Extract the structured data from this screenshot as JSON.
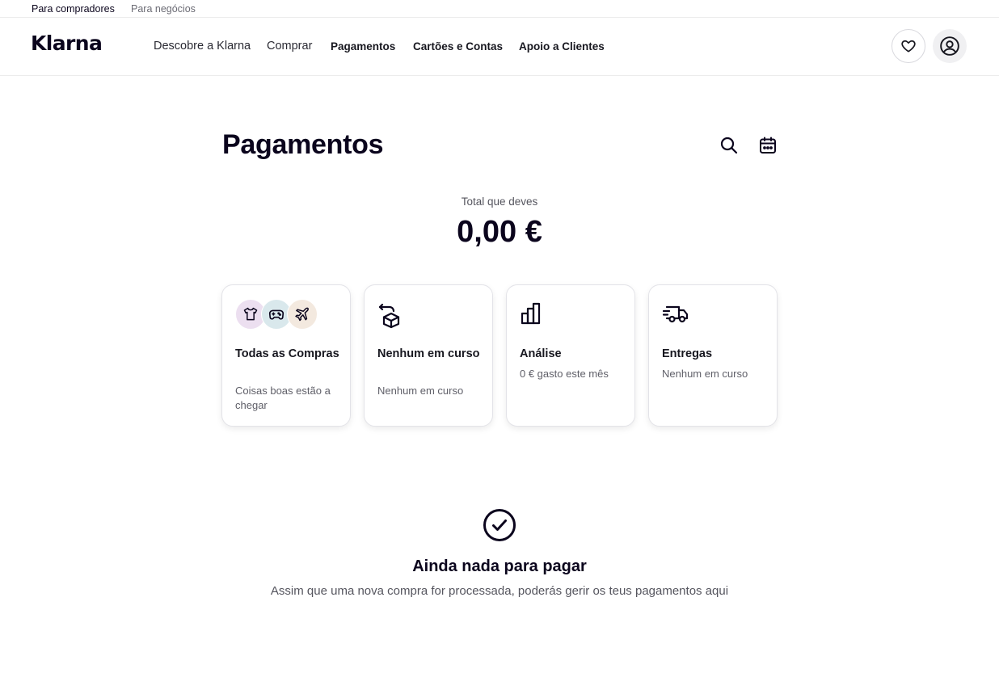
{
  "topbar": {
    "buyers": "Para compradores",
    "business": "Para negócios"
  },
  "nav": {
    "logo": "Klarna",
    "items": [
      "Descobre a Klarna",
      "Comprar",
      "Pagamentos",
      "Cartões e Contas",
      "Apoio a Clientes"
    ],
    "icons": [
      "heart-icon",
      "user-icon"
    ]
  },
  "page": {
    "title": "Pagamentos",
    "icons": [
      "search-icon",
      "calendar-icon"
    ],
    "total_label": "Total que deves",
    "total_amount": "0,00 €"
  },
  "cards": [
    {
      "title": "Todas as Compras",
      "subtitle": "Coisas boas estão a chegar",
      "icons": [
        "tshirt-icon",
        "gamepad-icon",
        "airplane-icon"
      ]
    },
    {
      "title": "Nenhum em curso",
      "subtitle": "Nenhum em curso",
      "icon": "return-box-icon"
    },
    {
      "title": "Análise",
      "subtitle": "0 € gasto este mês",
      "icon": "bar-chart-icon"
    },
    {
      "title": "Entregas",
      "subtitle": "Nenhum em curso",
      "icon": "truck-icon"
    }
  ],
  "empty_state": {
    "icon": "check-circle-icon",
    "title": "Ainda nada para pagar",
    "text": "Assim que uma nova compra for processada, poderás gerir os teus pagamentos aqui"
  },
  "colors": {
    "text": "#0b051d",
    "muted": "#55555e",
    "border": "#e3e3e8",
    "bubble_purple": "#ecdff0",
    "bubble_blue": "#d9e8ec",
    "bubble_peach": "#f3e9df"
  }
}
